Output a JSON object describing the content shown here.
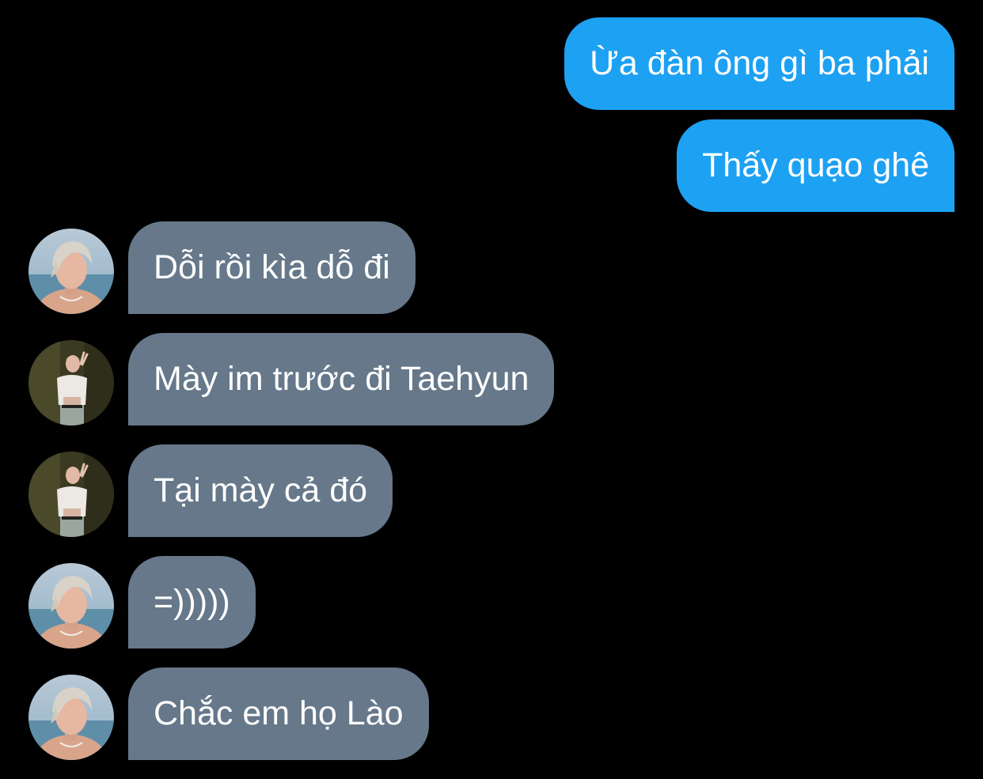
{
  "conversation": {
    "messages": [
      {
        "direction": "sent",
        "text": "Ừa đàn ông gì ba phải"
      },
      {
        "direction": "sent",
        "text": "Thấy quạo ghê"
      },
      {
        "direction": "received",
        "avatar": "avatar-blond-beach",
        "text": "Dỗi rồi kìa dỗ đi"
      },
      {
        "direction": "received",
        "avatar": "avatar-peace-sign",
        "text": "Mày im trước đi Taehyun"
      },
      {
        "direction": "received",
        "avatar": "avatar-peace-sign",
        "text": "Tại mày cả đó"
      },
      {
        "direction": "received",
        "avatar": "avatar-blond-beach",
        "text": "=)))))"
      },
      {
        "direction": "received",
        "avatar": "avatar-blond-beach",
        "text": "Chắc em họ Lào"
      }
    ]
  },
  "colors": {
    "background": "#000000",
    "sent_bubble": "#1da1f2",
    "received_bubble": "#66788a",
    "text": "#ffffff"
  }
}
